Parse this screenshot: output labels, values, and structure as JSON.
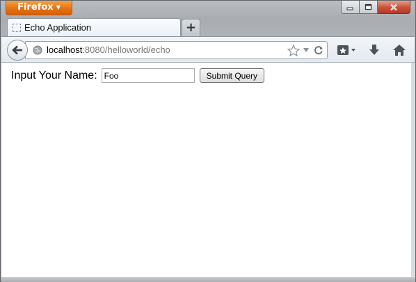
{
  "browser": {
    "menu_button_label": "Firefox",
    "tab": {
      "title": "Echo Application"
    },
    "new_tab_label": "+",
    "url": {
      "host": "localhost",
      "rest": ":8080/helloworld/echo"
    }
  },
  "page": {
    "form": {
      "label": "Input Your Name:",
      "name_value": "Foo",
      "submit_label": "Submit Query"
    }
  }
}
